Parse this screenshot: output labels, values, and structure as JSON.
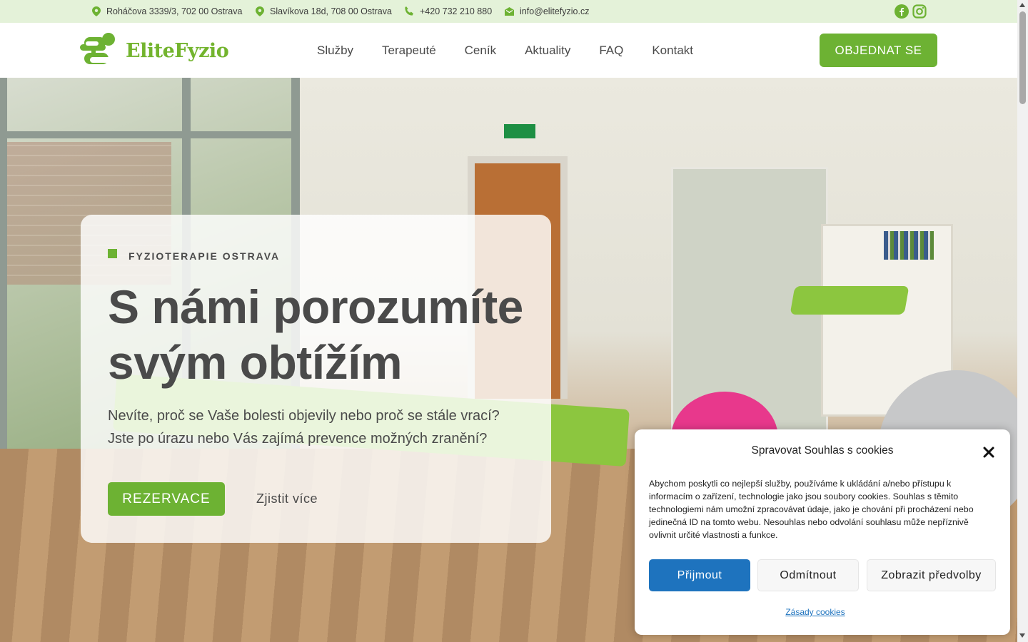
{
  "topbar": {
    "address1": "Roháčova 3339/3, 702 00 Ostrava",
    "address2": "Slavíkova 18d, 708 00 Ostrava",
    "phone": "+420 732 210 880",
    "email": "info@elitefyzio.cz",
    "icons": [
      "map-pin-icon",
      "map-pin-icon",
      "phone-icon",
      "envelope-icon",
      "facebook-icon",
      "instagram-icon"
    ]
  },
  "header": {
    "logo_text": "EliteFyzio",
    "nav": [
      "Služby",
      "Terapeuté",
      "Ceník",
      "Aktuality",
      "FAQ",
      "Kontakt"
    ],
    "cta": "OBJEDNAT SE"
  },
  "hero": {
    "eyebrow": "FYZIOTERAPIE OSTRAVA",
    "title_line1": "S námi porozumíte",
    "title_line2": "svým obtížím",
    "lead": "Nevíte, proč se Vaše bolesti objevily nebo proč se stále vrací? Jste po úrazu nebo Vás zajímá prevence možných zranění?",
    "primary_button": "REZERVACE",
    "secondary_button": "Zjistit více"
  },
  "cookie": {
    "title": "Spravovat Souhlas s cookies",
    "text": "Abychom poskytli co nejlepší služby, používáme k ukládání a/nebo přístupu k informacím o zařízení, technologie jako jsou soubory cookies. Souhlas s těmito technologiemi nám umožní zpracovávat údaje, jako je chování při procházení nebo jedinečná ID na tomto webu. Nesouhlas nebo odvolání souhlasu může nepříznivě ovlivnit určité vlastnosti a funkce.",
    "accept": "Přijmout",
    "deny": "Odmítnout",
    "prefs": "Zobrazit předvolby",
    "policy_link": "Zásady cookies"
  },
  "colors": {
    "brand_green": "#6db233",
    "topbar_bg": "#e4f2d9",
    "accept_blue": "#1e73be",
    "text": "#4a4a4a"
  }
}
